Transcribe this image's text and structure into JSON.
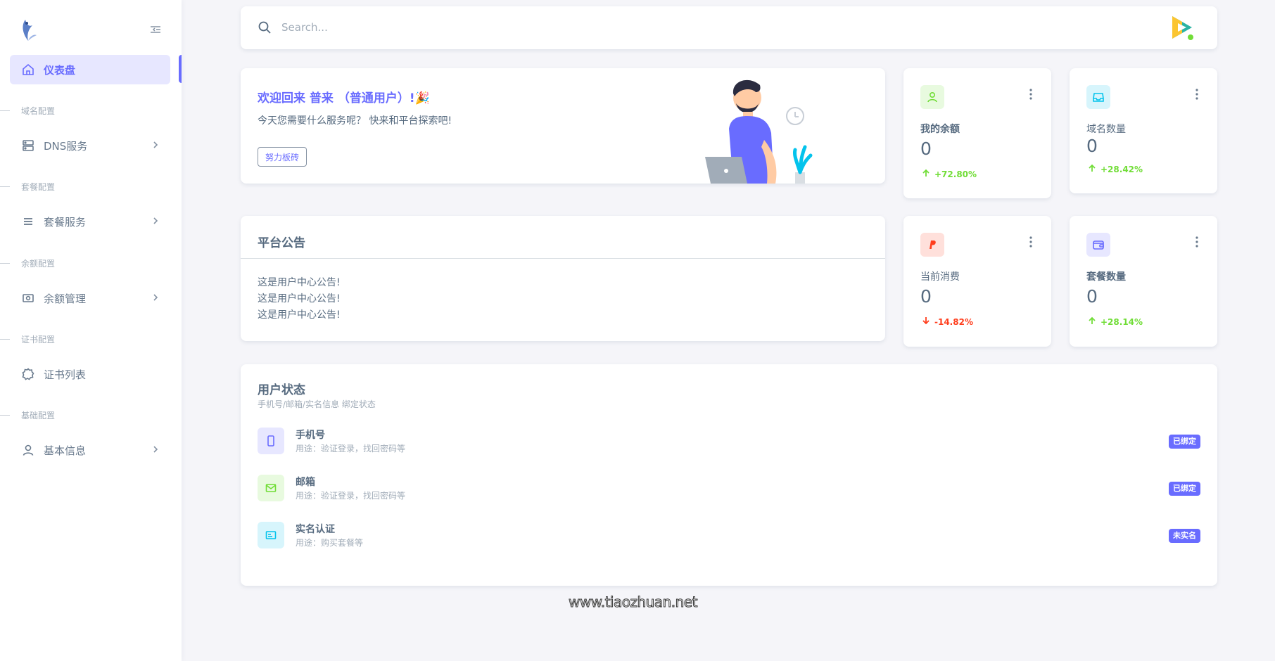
{
  "sidebar": {
    "items": [
      {
        "label": "仪表盘"
      },
      {
        "label": "DNS服务"
      },
      {
        "label": "套餐服务"
      },
      {
        "label": "余额管理"
      },
      {
        "label": "证书列表"
      },
      {
        "label": "基本信息"
      }
    ],
    "headers": [
      "域名配置",
      "套餐配置",
      "余额配置",
      "证书配置",
      "基础配置"
    ]
  },
  "search": {
    "placeholder": "Search..."
  },
  "welcome": {
    "title": "欢迎回来  普来 （普通用户）!🎉",
    "subtitle": "今天您需要什么服务呢？ 快来和平台探索吧!",
    "button": "努力板砖"
  },
  "announcement": {
    "title": "平台公告",
    "lines": [
      "这是用户中心公告!",
      "这是用户中心公告!",
      "这是用户中心公告!"
    ]
  },
  "stats": [
    {
      "label": "我的余额",
      "value": "0",
      "change": "+72.80%",
      "trend": "up",
      "color": "#71dd37",
      "bg": "#e8fadf"
    },
    {
      "label": "域名数量",
      "value": "0",
      "change": "+28.42%",
      "trend": "up",
      "color": "#03c3ec",
      "bg": "#d7f5fc"
    },
    {
      "label": "当前消费",
      "value": "0",
      "change": "-14.82%",
      "trend": "down",
      "color": "#ff3e1d",
      "bg": "#ffe0db"
    },
    {
      "label": "套餐数量",
      "value": "0",
      "change": "+28.14%",
      "trend": "up",
      "color": "#696cff",
      "bg": "#e7e7ff"
    }
  ],
  "user_status": {
    "title": "用户状态",
    "subtitle": "手机号/邮箱/实名信息 绑定状态",
    "rows": [
      {
        "name": "手机号",
        "desc": "用途：验证登录，找回密码等",
        "badge": "已绑定",
        "icon": "phone-icon"
      },
      {
        "name": "邮箱",
        "desc": "用途：验证登录，找回密码等",
        "badge": "已绑定",
        "icon": "mail-icon"
      },
      {
        "name": "实名认证",
        "desc": "用途：购买套餐等",
        "badge": "未实名",
        "icon": "id-card-icon"
      }
    ]
  },
  "watermark": "www.tiaozhuan.net",
  "colors": {
    "primary": "#696cff",
    "success": "#71dd37",
    "danger": "#ff3e1d",
    "info": "#03c3ec"
  }
}
